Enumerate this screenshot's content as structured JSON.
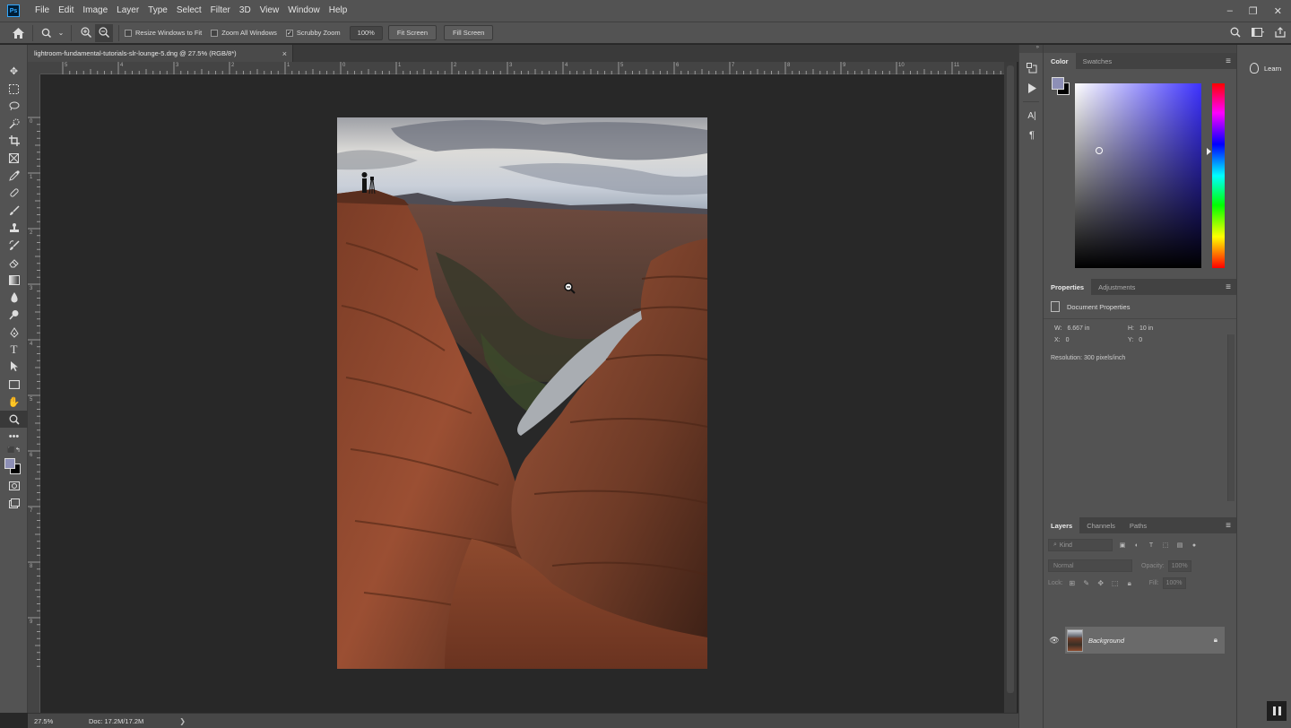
{
  "menu": {
    "app_icon": "Ps",
    "items": [
      "File",
      "Edit",
      "Image",
      "Layer",
      "Type",
      "Select",
      "Filter",
      "3D",
      "View",
      "Window",
      "Help"
    ]
  },
  "options": {
    "resize_windows": "Resize Windows to Fit",
    "zoom_all": "Zoom All Windows",
    "scrubby_zoom": "Scrubby Zoom",
    "zoom_value": "100%",
    "fit_screen": "Fit Screen",
    "fill_screen": "Fill Screen"
  },
  "document": {
    "tab_title": "lightroom-fundamental-tutorials-slr-lounge-5.dng @ 27.5% (RGB/8*)",
    "close_glyph": "×"
  },
  "ruler": {
    "h_labels": [
      "5",
      "4",
      "3",
      "2",
      "1",
      "0",
      "1",
      "2",
      "3",
      "4",
      "5",
      "6",
      "7",
      "8",
      "9",
      "10",
      "11"
    ],
    "v_labels": [
      "0",
      "1",
      "2",
      "3",
      "4",
      "5",
      "6",
      "7",
      "8",
      "9"
    ]
  },
  "status": {
    "zoom": "27.5%",
    "doc": "Doc: 17.2M/17.2M",
    "arrow": "❯"
  },
  "color_panel": {
    "tabs": [
      "Color",
      "Swatches"
    ],
    "foreground": "#8d8fb6",
    "background": "#000000"
  },
  "properties_panel": {
    "tabs": [
      "Properties",
      "Adjustments"
    ],
    "title": "Document Properties",
    "w_label": "W:",
    "w_value": "6.667 in",
    "h_label": "H:",
    "h_value": "10 in",
    "x_label": "X:",
    "x_value": "0",
    "y_label": "Y:",
    "y_value": "0",
    "resolution": "Resolution: 300 pixels/inch"
  },
  "layers_panel": {
    "tabs": [
      "Layers",
      "Channels",
      "Paths"
    ],
    "kind_placeholder": "Kind",
    "blend_mode": "Normal",
    "opacity_label": "Opacity:",
    "opacity_value": "100%",
    "lock_label": "Lock:",
    "fill_label": "Fill:",
    "fill_value": "100%",
    "layer_name": "Background"
  },
  "learn": {
    "label": "Learn"
  }
}
